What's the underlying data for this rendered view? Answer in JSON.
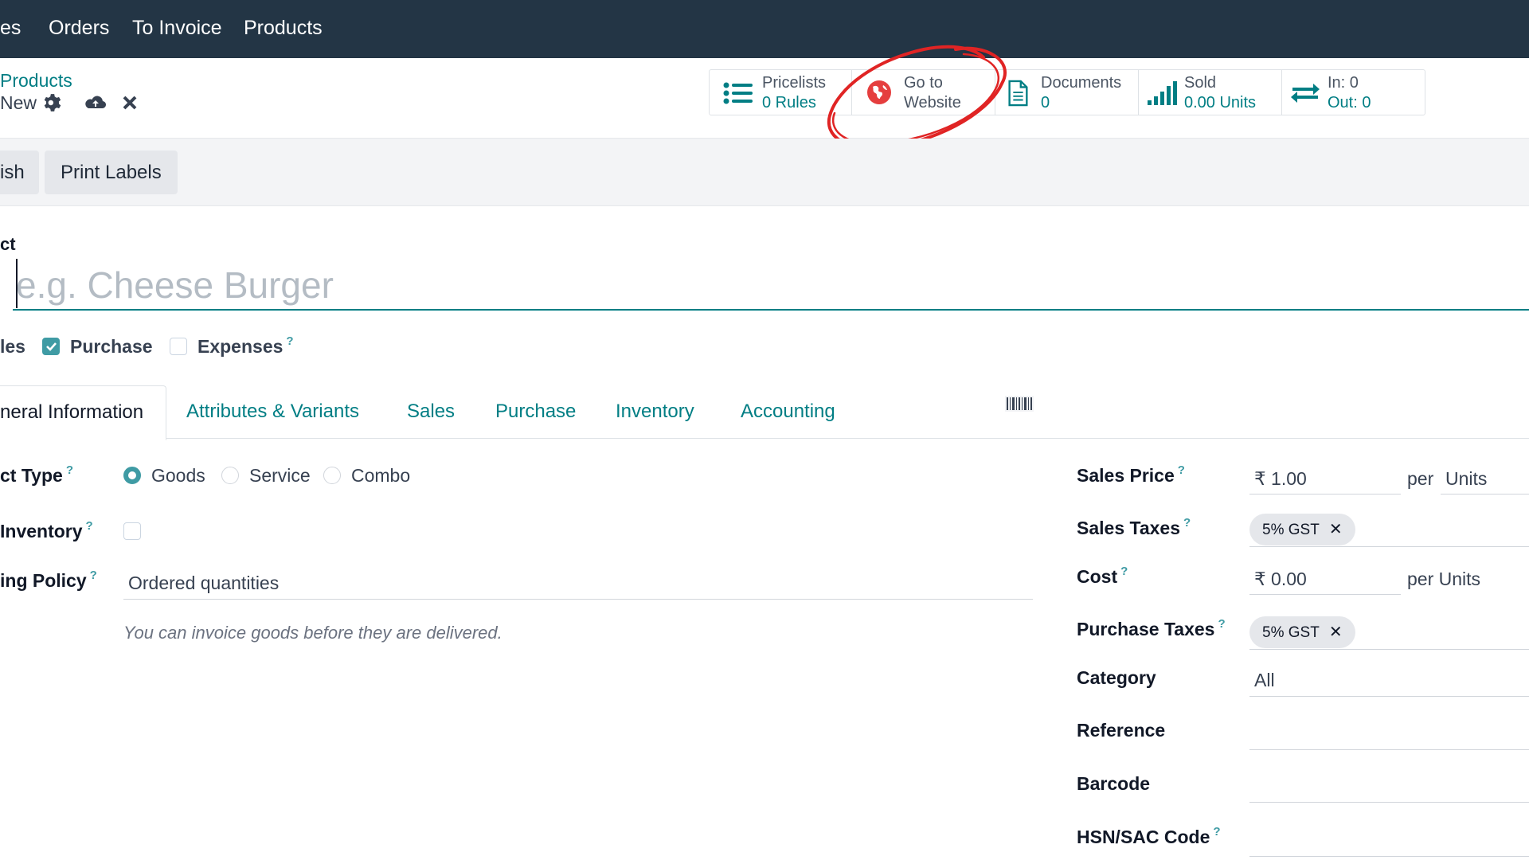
{
  "topnav": {
    "items": [
      "es",
      "Orders",
      "To Invoice",
      "Products"
    ]
  },
  "breadcrumb": {
    "parent": "Products",
    "current": "New"
  },
  "smart_buttons": [
    {
      "line1": "Pricelists",
      "line2": "0  Rules",
      "icon": "list-icon"
    },
    {
      "line1": "Go to",
      "line2": "Website",
      "icon": "globe-icon"
    },
    {
      "line1": "Documents",
      "line2": "0",
      "icon": "document-icon"
    },
    {
      "line1": "Sold",
      "line2": "0.00 Units",
      "icon": "bar-chart-icon"
    },
    {
      "line1": "In: 0",
      "line2": "Out: 0",
      "icon": "exchange-arrows-icon"
    }
  ],
  "status_buttons": {
    "publish": "ish",
    "print_labels": "Print Labels"
  },
  "product": {
    "name_label": "ct",
    "name_placeholder": "e.g. Cheese Burger"
  },
  "options": {
    "sales": "les",
    "purchase": "Purchase",
    "expenses": "Expenses",
    "purchase_checked": true,
    "expenses_checked": false
  },
  "tabs": [
    "neral Information",
    "Attributes & Variants",
    "Sales",
    "Purchase",
    "Inventory",
    "Accounting"
  ],
  "left_form": {
    "product_type_label": "ct Type",
    "type_options": [
      "Goods",
      "Service",
      "Combo"
    ],
    "selected_type": "Goods",
    "inventory_label": "Inventory",
    "invoicing_policy_label": "ing Policy",
    "invoicing_policy_value": "Ordered quantities",
    "hint": "You can invoice goods before they are delivered."
  },
  "right_form": {
    "sales_price_label": "Sales Price",
    "sales_price_value": "₹ 1.00",
    "per": "per",
    "sales_price_uom": "Units",
    "sales_taxes_label": "Sales Taxes",
    "sales_tax_tag": "5% GST",
    "cost_label": "Cost",
    "cost_value": "₹ 0.00",
    "cost_uom": "per Units",
    "purchase_taxes_label": "Purchase Taxes",
    "purchase_tax_tag": "5% GST",
    "category_label": "Category",
    "category_value": "All",
    "reference_label": "Reference",
    "barcode_label": "Barcode",
    "hsn_label": "HSN/SAC Code"
  },
  "colors": {
    "topbar": "#233545",
    "accent": "#017e84",
    "check": "#3f9ba4",
    "annotation": "#e02424"
  },
  "help_mark": "?"
}
